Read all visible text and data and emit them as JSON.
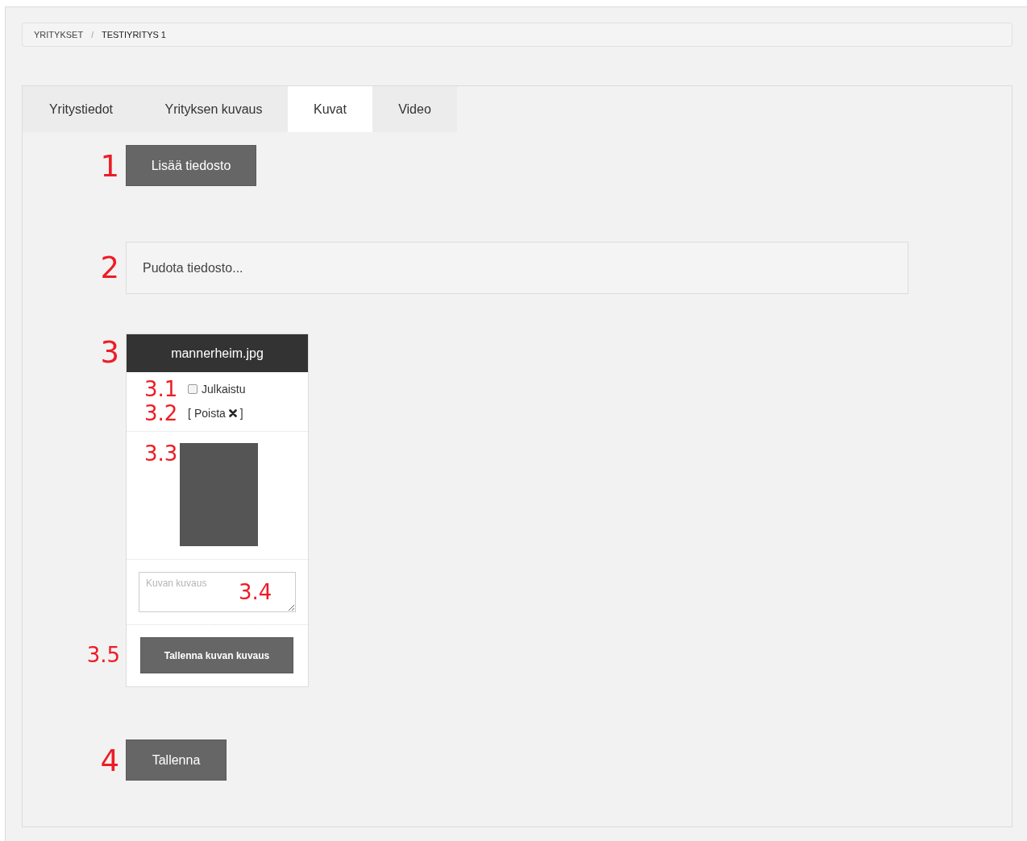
{
  "breadcrumb": {
    "items": [
      "YRITYKSET",
      "TESTIYRITYS 1"
    ],
    "separator": "/"
  },
  "tabs": [
    {
      "label": "Yritystiedot",
      "selected": false
    },
    {
      "label": "Yrityksen kuvaus",
      "selected": false
    },
    {
      "label": "Kuvat",
      "selected": true
    },
    {
      "label": "Video",
      "selected": false
    }
  ],
  "add_file": {
    "marker": "1",
    "label": "Lisää tiedosto"
  },
  "dropzone": {
    "marker": "2",
    "text": "Pudota tiedosto..."
  },
  "image_card": {
    "marker": "3",
    "title": "mannerheim.jpg",
    "published": {
      "marker": "3.1",
      "label": "Julkaistu",
      "checked": false
    },
    "delete": {
      "marker": "3.2",
      "bracket_open": "[",
      "label": "Poista",
      "bracket_close": "]"
    },
    "photo": {
      "marker": "3.3"
    },
    "description": {
      "marker": "3.4",
      "placeholder": "Kuvan kuvaus"
    },
    "save": {
      "marker": "3.5",
      "label": "Tallenna kuvan kuvaus"
    }
  },
  "save": {
    "marker": "4",
    "label": "Tallenna"
  }
}
